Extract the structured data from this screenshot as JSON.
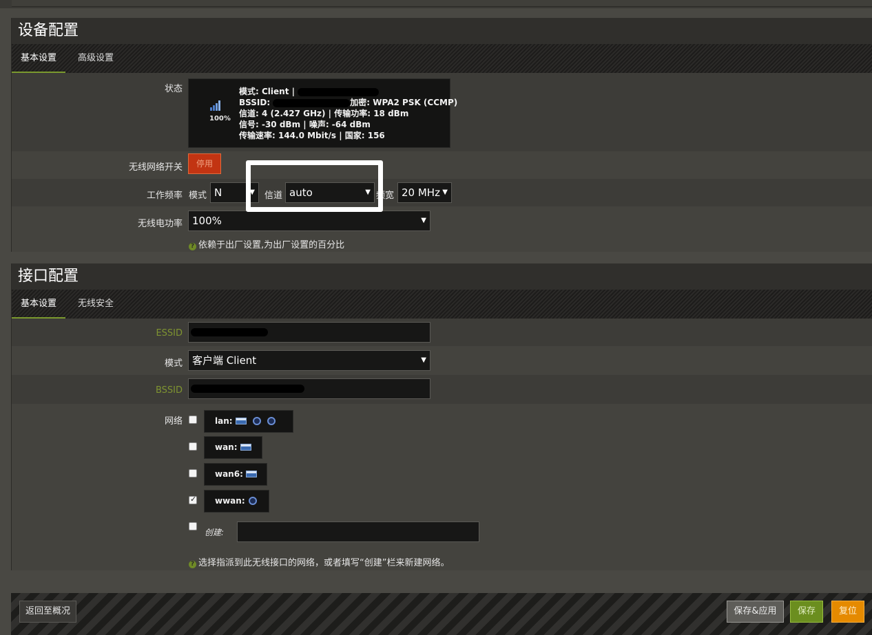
{
  "device": {
    "title": "设备配置",
    "tabs": [
      {
        "label": "基本设置"
      },
      {
        "label": "高级设置"
      }
    ],
    "status": {
      "label": "状态",
      "signal_pct": "100%",
      "line1_prefix": "模式: Client | ",
      "line2_prefix": "BSSID: ",
      "line2_suffix": "加密: WPA2 PSK (CCMP)",
      "line3": "信道: 4 (2.427 GHz) | 传输功率: 18 dBm",
      "line4": "信号: -30 dBm | 噪声: -64 dBm",
      "line5": "传输速率: 144.0 Mbit/s | 国家: 156"
    },
    "wifi_switch": {
      "label": "无线网络开关",
      "button": "停用"
    },
    "frequency": {
      "label": "工作频率",
      "mode_label": "模式",
      "mode_value": "N",
      "channel_label": "信道",
      "channel_value": "auto",
      "width_label": "频宽",
      "width_value": "20 MHz"
    },
    "txpower": {
      "label": "无线电功率",
      "value": "100%",
      "hint": "依赖于出厂设置,为出厂设置的百分比"
    }
  },
  "iface": {
    "title": "接口配置",
    "tabs": [
      {
        "label": "基本设置"
      },
      {
        "label": "无线安全"
      }
    ],
    "essid_label": "ESSID",
    "mode_label": "模式",
    "mode_value": "客户端 Client",
    "bssid_label": "BSSID",
    "network_label": "网络",
    "networks": [
      {
        "name": "lan:",
        "checked": false
      },
      {
        "name": "wan:",
        "checked": false
      },
      {
        "name": "wan6:",
        "checked": false
      },
      {
        "name": "wwan:",
        "checked": true
      }
    ],
    "create_label": "创建:",
    "network_hint": "选择指派到此无线接口的网络，或者填写“创建”栏来新建网络。"
  },
  "footer": {
    "back": "返回至概况",
    "save_apply": "保存&应用",
    "save": "保存",
    "reset": "复位"
  },
  "colors": {
    "accent_green": "#7b9a2e",
    "danger_red": "#c23412",
    "reset_orange": "#e58a00"
  }
}
